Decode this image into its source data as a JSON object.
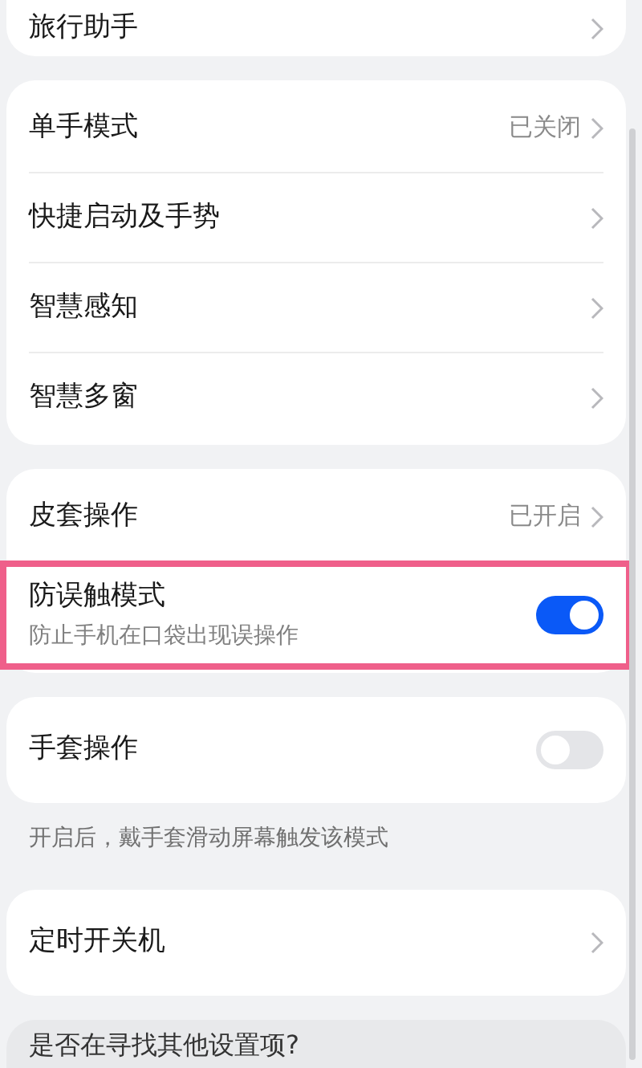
{
  "groups": [
    {
      "items": [
        {
          "kind": "link",
          "label": "旅行助手",
          "highlighted": false
        }
      ]
    },
    {
      "items": [
        {
          "kind": "link",
          "label": "单手模式",
          "value": "已关闭",
          "highlighted": false
        },
        {
          "kind": "link",
          "label": "快捷启动及手势",
          "highlighted": false
        },
        {
          "kind": "link",
          "label": "智慧感知",
          "highlighted": false
        },
        {
          "kind": "link",
          "label": "智慧多窗",
          "highlighted": false
        }
      ]
    },
    {
      "items": [
        {
          "kind": "link",
          "label": "皮套操作",
          "value": "已开启",
          "highlighted": false
        },
        {
          "kind": "toggle",
          "label": "防误触模式",
          "description": "防止手机在口袋出现误操作",
          "on": true,
          "highlighted": true
        }
      ]
    },
    {
      "items": [
        {
          "kind": "toggle",
          "label": "手套操作",
          "on": false,
          "highlighted": false
        }
      ],
      "caption": "开启后，戴手套滑动屏幕触发该模式"
    },
    {
      "items": [
        {
          "kind": "link",
          "label": "定时开关机",
          "highlighted": false
        }
      ]
    }
  ],
  "suggestion": {
    "title": "是否在寻找其他设置项?"
  }
}
